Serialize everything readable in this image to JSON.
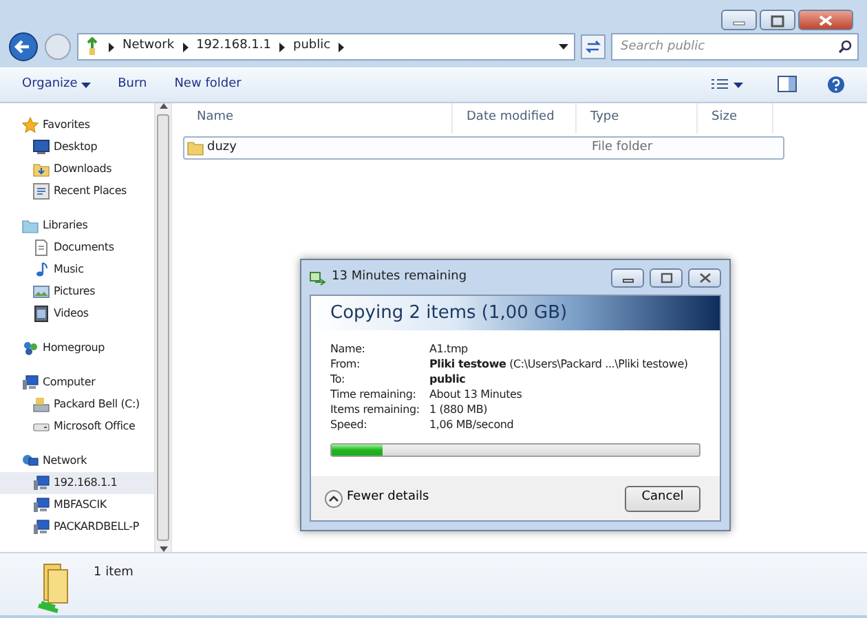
{
  "address_bar": {
    "crumbs": [
      "Network",
      "192.168.1.1",
      "public"
    ]
  },
  "search": {
    "placeholder": "Search public"
  },
  "toolbar": {
    "items": [
      {
        "label": "Organize",
        "dropdown": true
      },
      {
        "label": "Burn",
        "dropdown": false
      },
      {
        "label": "New folder",
        "dropdown": false
      }
    ]
  },
  "sidebar": {
    "groups": [
      {
        "label": "Favorites",
        "children": [
          {
            "label": "Desktop",
            "selected": false
          },
          {
            "label": "Downloads",
            "selected": false
          },
          {
            "label": "Recent Places",
            "selected": false
          }
        ]
      },
      {
        "label": "Libraries",
        "children": [
          {
            "label": "Documents",
            "selected": false
          },
          {
            "label": "Music",
            "selected": false
          },
          {
            "label": "Pictures",
            "selected": false
          },
          {
            "label": "Videos",
            "selected": false
          }
        ]
      },
      {
        "label": "Homegroup"
      },
      {
        "label": "Computer",
        "children": [
          {
            "label": "Packard Bell (C:)",
            "selected": false
          },
          {
            "label": "Microsoft Office",
            "selected": false
          }
        ]
      },
      {
        "label": "Network",
        "children": [
          {
            "label": "192.168.1.1",
            "selected": true
          },
          {
            "label": "MBFASCIK",
            "selected": false
          },
          {
            "label": "PACKARDBELL-P",
            "selected": false
          }
        ]
      }
    ]
  },
  "table": {
    "columns": [
      "Name",
      "Date modified",
      "Type",
      "Size"
    ],
    "rows": [
      {
        "name": "duzy",
        "type": "File folder",
        "selected": true
      }
    ]
  },
  "status_bar": {
    "text": "1 item"
  },
  "copy_dialog": {
    "title": "13 Minutes remaining",
    "heading": "Copying 2 items (1,00 GB)",
    "details": [
      {
        "label": "Name:",
        "value": "A1.tmp"
      },
      {
        "label": "From:",
        "value": "**Pliki testowe** (C:\\Users\\Packard ...\\Pliki testowe)"
      },
      {
        "label": "To:",
        "value": "**public**"
      },
      {
        "label": "Time remaining:",
        "value": "About 13 Minutes"
      },
      {
        "label": "Items remaining:",
        "value": "1 (880 MB)"
      },
      {
        "label": "Speed:",
        "value": "1,06 MB/second"
      }
    ],
    "progress": {
      "level": 0.14
    },
    "details_toggle": "Fewer details",
    "cancel_button": "Cancel"
  }
}
